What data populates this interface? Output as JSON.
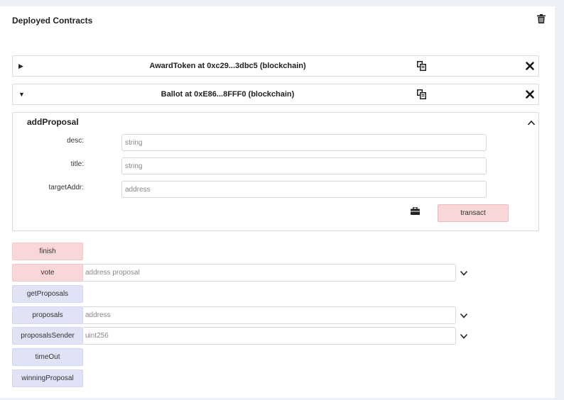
{
  "panel": {
    "title": "Deployed Contracts"
  },
  "contracts": [
    {
      "caret": "▶",
      "name": "AwardToken at 0xc29...3dbc5 (blockchain)",
      "expanded": false
    },
    {
      "caret": "▼",
      "name": "Ballot at 0xE86...8FFF0 (blockchain)",
      "expanded": true
    }
  ],
  "add_proposal": {
    "title": "addProposal",
    "params": [
      {
        "label": "desc:",
        "placeholder": "string"
      },
      {
        "label": "title:",
        "placeholder": "string"
      },
      {
        "label": "targetAddr:",
        "placeholder": "address"
      }
    ],
    "transact_label": "transact"
  },
  "functions": [
    {
      "label": "finish",
      "kind": "transact"
    },
    {
      "label": "vote",
      "kind": "transact",
      "placeholder": "address proposal"
    },
    {
      "label": "getProposals",
      "kind": "call"
    },
    {
      "label": "proposals",
      "kind": "call",
      "placeholder": "address"
    },
    {
      "label": "proposalsSender",
      "kind": "call",
      "placeholder": "uint256"
    },
    {
      "label": "timeOut",
      "kind": "call"
    },
    {
      "label": "winningProposal",
      "kind": "call"
    }
  ],
  "colors": {
    "transact": "#f9d6d7",
    "call": "#e0e3f6",
    "background": "#eef0f7"
  },
  "icons": [
    "trash-icon",
    "copy-icon",
    "close-icon",
    "chevron-up-icon",
    "chevron-down-icon",
    "briefcase-icon"
  ]
}
